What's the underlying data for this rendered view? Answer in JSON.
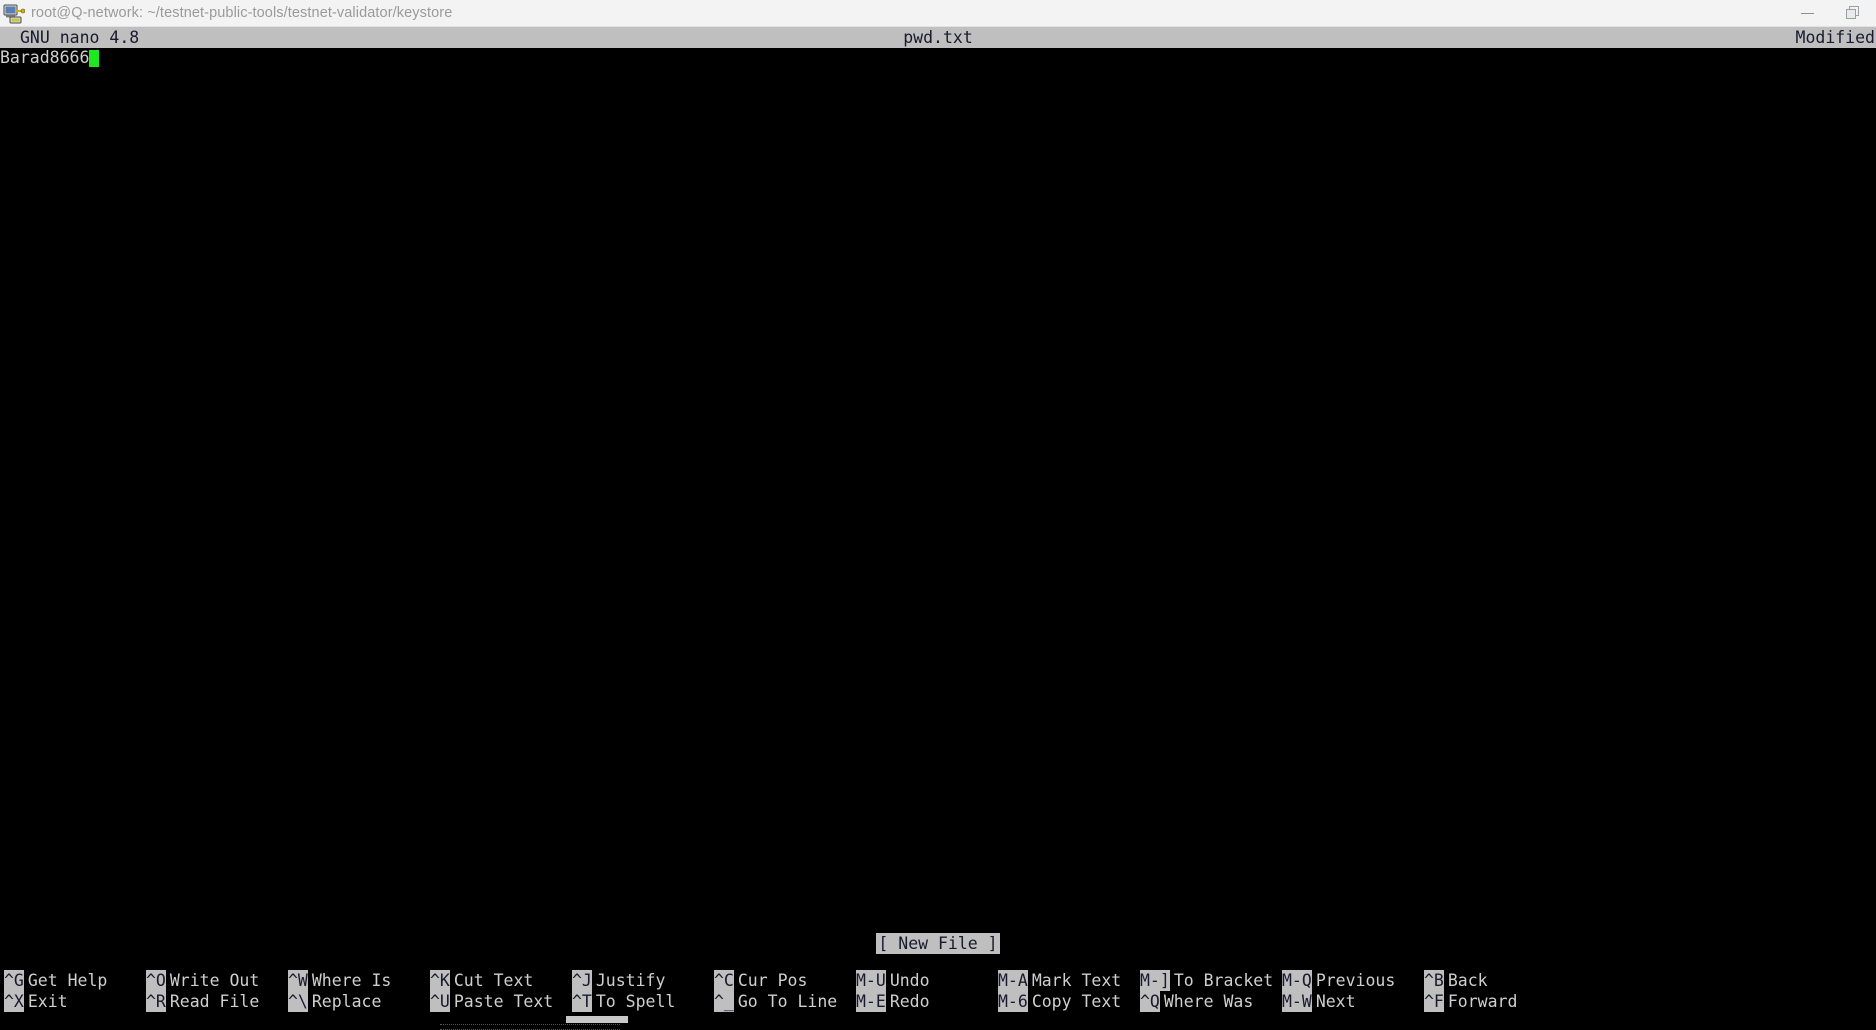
{
  "window": {
    "title": "root@Q-network: ~/testnet-public-tools/testnet-validator/keystore",
    "icon": "putty-terminal-icon",
    "controls": {
      "minimize_label": "—",
      "restore_label": "❐"
    }
  },
  "nano": {
    "version": "GNU nano 4.8",
    "filename": "pwd.txt",
    "modified_flag": "Modified",
    "status_message": "[ New File ]",
    "buffer_lines": [
      "Barad8666"
    ],
    "cursor": {
      "line": 1,
      "column": 10,
      "color": "#1ee81e"
    },
    "colors": {
      "background": "#000000",
      "foreground": "#cfcfcf",
      "inverse_background": "#bfbfbf",
      "inverse_foreground": "#1a1a2e"
    },
    "shortcuts_row1": [
      {
        "key": "^G",
        "label": "Get Help"
      },
      {
        "key": "^O",
        "label": "Write Out"
      },
      {
        "key": "^W",
        "label": "Where Is"
      },
      {
        "key": "^K",
        "label": "Cut Text"
      },
      {
        "key": "^J",
        "label": "Justify"
      },
      {
        "key": "^C",
        "label": "Cur Pos"
      },
      {
        "key": "M-U",
        "label": "Undo"
      },
      {
        "key": "M-A",
        "label": "Mark Text"
      },
      {
        "key": "M-]",
        "label": "To Bracket"
      },
      {
        "key": "M-Q",
        "label": "Previous"
      },
      {
        "key": "^B",
        "label": "Back"
      }
    ],
    "shortcuts_row2": [
      {
        "key": "^X",
        "label": "Exit"
      },
      {
        "key": "^R",
        "label": "Read File"
      },
      {
        "key": "^\\",
        "label": "Replace"
      },
      {
        "key": "^U",
        "label": "Paste Text"
      },
      {
        "key": "^T",
        "label": "To Spell"
      },
      {
        "key": "^_",
        "label": "Go To Line"
      },
      {
        "key": "M-E",
        "label": "Redo"
      },
      {
        "key": "M-6",
        "label": "Copy Text"
      },
      {
        "key": "^Q",
        "label": "Where Was"
      },
      {
        "key": "M-W",
        "label": "Next"
      },
      {
        "key": "^F",
        "label": "Forward"
      }
    ]
  }
}
